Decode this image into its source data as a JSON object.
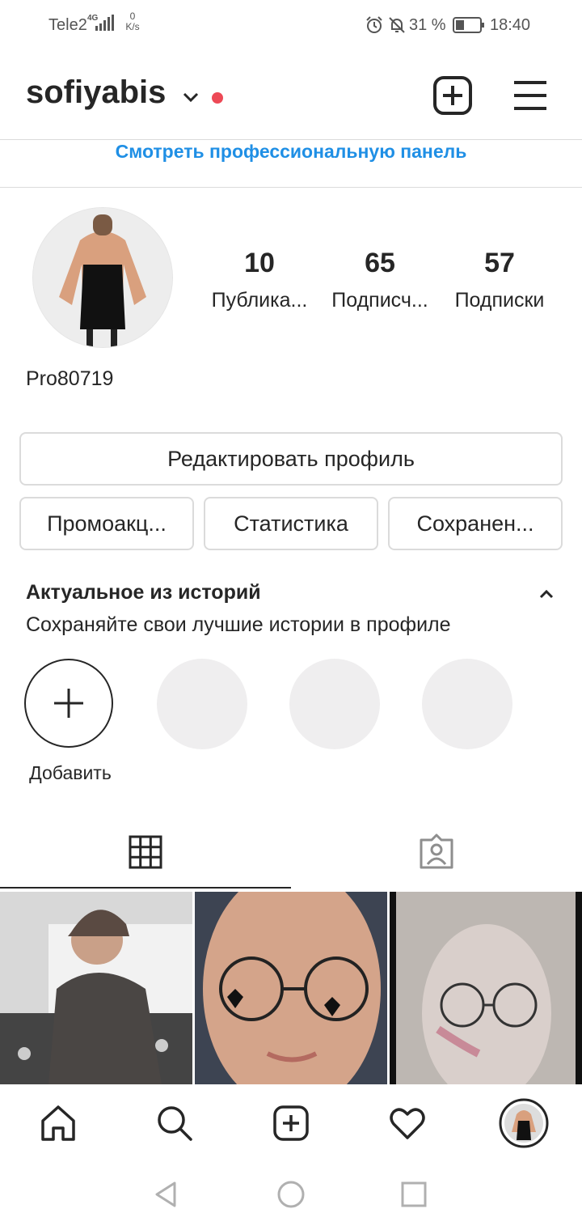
{
  "status_bar": {
    "carrier": "Tele2",
    "net_type": "4G",
    "speed_value": "0",
    "speed_unit": "K/s",
    "battery_percent": "31 %",
    "time": "18:40"
  },
  "header": {
    "username": "sofiyabis"
  },
  "pro_panel_link": "Смотреть профессиональную панель",
  "profile": {
    "display_name": "Pro80719",
    "stats": [
      {
        "value": "10",
        "label": "Публика..."
      },
      {
        "value": "65",
        "label": "Подписч..."
      },
      {
        "value": "57",
        "label": "Подписки"
      }
    ]
  },
  "buttons": {
    "edit_profile": "Редактировать профиль",
    "promotions": "Промоакц...",
    "insights": "Статистика",
    "saved": "Сохранен..."
  },
  "highlights": {
    "title": "Актуальное из историй",
    "subtitle": "Сохраняйте свои лучшие истории в профиле",
    "add_label": "Добавить"
  },
  "tabs": [
    {
      "icon": "grid-icon",
      "active": true
    },
    {
      "icon": "tagged-person-icon",
      "active": false
    }
  ],
  "bottom_nav": [
    "home-icon",
    "search-icon",
    "new-post-icon",
    "heart-icon",
    "profile-avatar"
  ],
  "colors": {
    "link_blue": "#1f8fe5",
    "notification_red": "#ed4956",
    "text": "#262626",
    "border": "#dbdbdb",
    "placeholder": "#efeeef"
  }
}
